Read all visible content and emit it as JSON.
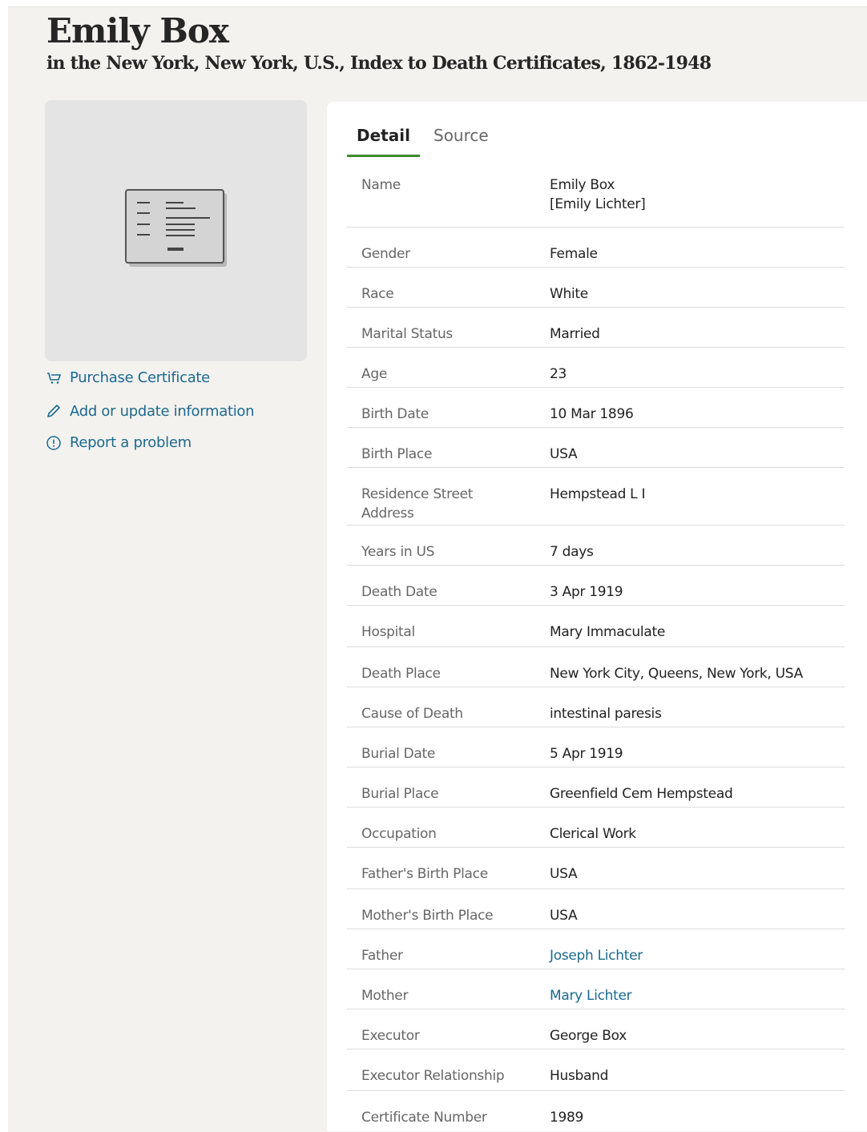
{
  "header": {
    "title": "Emily Box",
    "subtitle": "in the New York, New York, U.S., Index to Death Certificates, 1862-1948"
  },
  "sidebar": {
    "actions": [
      {
        "label": "Purchase Certificate",
        "icon": "cart-icon"
      },
      {
        "label": "Add or update information",
        "icon": "pencil-icon"
      },
      {
        "label": "Report a problem",
        "icon": "alert-circle-icon"
      }
    ]
  },
  "tabs": [
    {
      "label": "Detail",
      "active": true
    },
    {
      "label": "Source",
      "active": false
    }
  ],
  "details": [
    {
      "label": "Name",
      "value": "Emily Box",
      "value2": "[Emily Lichter]"
    },
    {
      "label": "Gender",
      "value": "Female"
    },
    {
      "label": "Race",
      "value": "White"
    },
    {
      "label": "Marital Status",
      "value": "Married"
    },
    {
      "label": "Age",
      "value": "23"
    },
    {
      "label": "Birth Date",
      "value": "10 Mar 1896"
    },
    {
      "label": "Birth Place",
      "value": "USA"
    },
    {
      "label": "Residence Street Address",
      "value": "Hempstead L I"
    },
    {
      "label": "Years in US",
      "value": "7 days"
    },
    {
      "label": "Death Date",
      "value": "3 Apr 1919"
    },
    {
      "label": "Hospital",
      "value": "Mary Immaculate"
    },
    {
      "label": "Death Place",
      "value": "New York City, Queens, New York, USA"
    },
    {
      "label": "Cause of Death",
      "value": "intestinal paresis"
    },
    {
      "label": "Burial Date",
      "value": "5 Apr 1919"
    },
    {
      "label": "Burial Place",
      "value": "Greenfield Cem Hempstead"
    },
    {
      "label": "Occupation",
      "value": "Clerical Work"
    },
    {
      "label": "Father's Birth Place",
      "value": "USA"
    },
    {
      "label": "Mother's Birth Place",
      "value": "USA"
    },
    {
      "label": "Father",
      "value": "Joseph Lichter",
      "link": true
    },
    {
      "label": "Mother",
      "value": "Mary Lichter",
      "link": true
    },
    {
      "label": "Executor",
      "value": "George Box"
    },
    {
      "label": "Executor Relationship",
      "value": "Husband"
    },
    {
      "label": "Certificate Number",
      "value": "1989"
    }
  ],
  "colors": {
    "link": "#1b6a8e",
    "tab_underline": "#3d8a2c",
    "page_background": "#f4f2ef"
  }
}
